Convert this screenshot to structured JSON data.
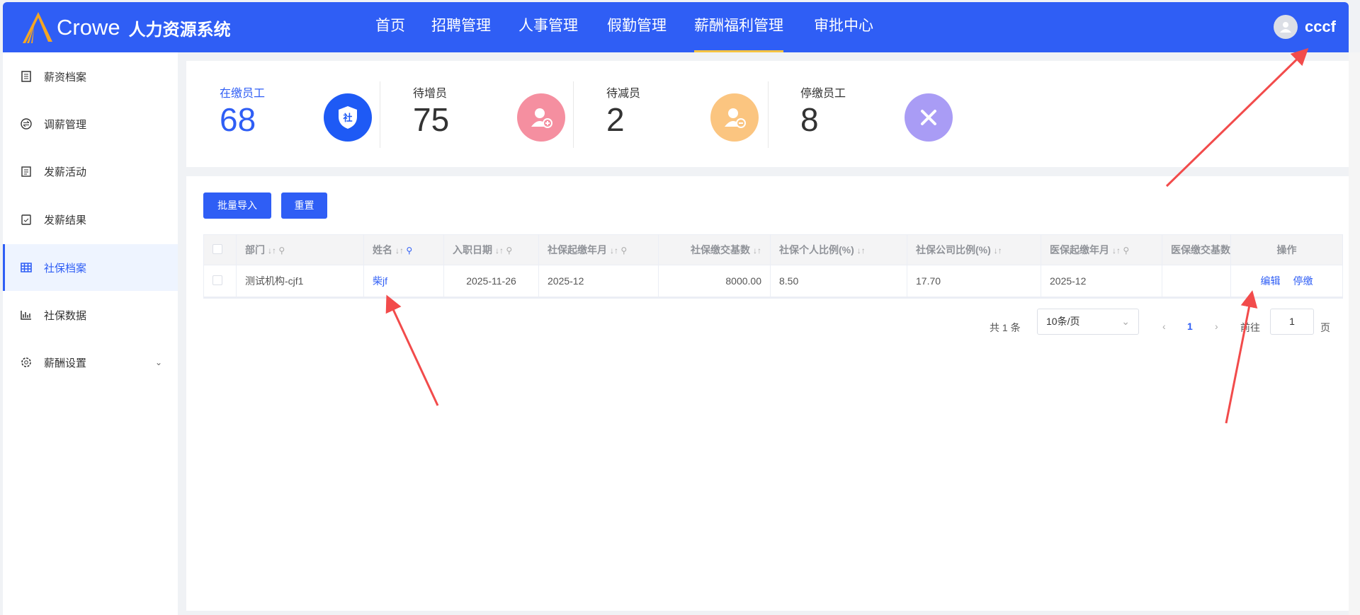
{
  "header": {
    "brand": "Crowe",
    "system": "人力资源系统",
    "nav": [
      "首页",
      "招聘管理",
      "人事管理",
      "假勤管理",
      "薪酬福利管理",
      "审批中心"
    ],
    "active_nav": "薪酬福利管理",
    "user": "cccf"
  },
  "sidebar": {
    "items": [
      {
        "label": "薪资档案",
        "icon": "document-icon"
      },
      {
        "label": "调薪管理",
        "icon": "exchange-icon"
      },
      {
        "label": "发薪活动",
        "icon": "clipboard-icon"
      },
      {
        "label": "发薪结果",
        "icon": "clipboard-check-icon"
      },
      {
        "label": "社保档案",
        "icon": "grid-icon"
      },
      {
        "label": "社保数据",
        "icon": "bar-chart-icon"
      },
      {
        "label": "薪酬设置",
        "icon": "gear-icon"
      }
    ],
    "active": "社保档案"
  },
  "stats": [
    {
      "label": "在缴员工",
      "value": "68",
      "color": "#1e5af5",
      "icon_text": "社"
    },
    {
      "label": "待增员",
      "value": "75",
      "color": "#f58fa0"
    },
    {
      "label": "待减员",
      "value": "2",
      "color": "#fbc580"
    },
    {
      "label": "停缴员工",
      "value": "8",
      "color": "#a99cf5"
    }
  ],
  "toolbar": {
    "import": "批量导入",
    "reset": "重置"
  },
  "table": {
    "columns": [
      "部门",
      "姓名",
      "入职日期",
      "社保起缴年月",
      "社保缴交基数",
      "社保个人比例(%)",
      "社保公司比例(%)",
      "医保起缴年月",
      "医保缴交基数",
      "操作"
    ],
    "rows": [
      {
        "dept": "测试机构-cjf1",
        "name": "柴jf",
        "hire_date": "2025-11-26",
        "si_start": "2025-12",
        "si_base": "8000.00",
        "si_personal": "8.50",
        "si_company": "17.70",
        "mi_start": "2025-12",
        "mi_base": "",
        "actions": [
          "编辑",
          "停缴"
        ]
      }
    ]
  },
  "pagination": {
    "total": "共 1 条",
    "page_size": "10条/页",
    "current": "1",
    "goto": "前往",
    "goto_value": "1",
    "page_suffix": "页"
  },
  "annotation_color": "#f24b4b"
}
